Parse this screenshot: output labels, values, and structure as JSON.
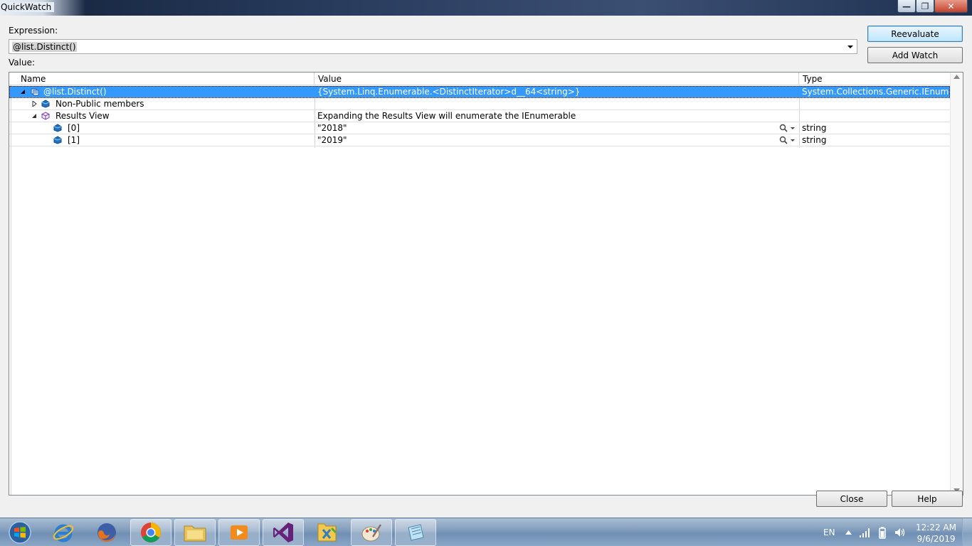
{
  "window": {
    "title": "QuickWatch",
    "min_glyph": "—",
    "max_glyph": "❐",
    "close_glyph": "✕"
  },
  "expression": {
    "label": "Expression:",
    "value": "@list.Distinct()"
  },
  "value_label": "Value:",
  "buttons": {
    "reevaluate": "Reevaluate",
    "add_watch": "Add Watch",
    "close": "Close",
    "help": "Help"
  },
  "grid": {
    "columns": [
      "Name",
      "Value",
      "Type"
    ],
    "rows": [
      {
        "name": "@list.Distinct()",
        "value": "{System.Linq.Enumerable.<DistinctIterator>d__64<string>}",
        "type": "System.Collections.Generic.IEnumera...",
        "expander": "expanded",
        "icon": "enumerable-icon",
        "selected": true
      },
      {
        "name": "Non-Public members",
        "value": "",
        "type": "",
        "expander": "collapsed",
        "icon": "field-icon",
        "selected": false
      },
      {
        "name": "Results View",
        "value": "Expanding the Results View will enumerate the IEnumerable",
        "type": "",
        "expander": "expanded",
        "icon": "results-view-icon",
        "selected": false
      },
      {
        "name": "[0]",
        "value": "\"2018\"",
        "type": "string",
        "expander": "none",
        "icon": "field-icon",
        "selected": false,
        "visualizer": "magnifier-icon"
      },
      {
        "name": "[1]",
        "value": "\"2019\"",
        "type": "string",
        "expander": "none",
        "icon": "field-icon",
        "selected": false,
        "visualizer": "magnifier-icon"
      }
    ]
  },
  "taskbar": {
    "apps": [
      "start-orb",
      "internet-explorer-icon",
      "firefox-icon",
      "chrome-icon",
      "file-explorer-icon",
      "media-player-icon",
      "visual-studio-icon",
      "xml-tool-icon",
      "paint-icon",
      "notepad-icon"
    ],
    "language": "EN",
    "time": "12:22 AM",
    "date": "9/6/2019"
  }
}
